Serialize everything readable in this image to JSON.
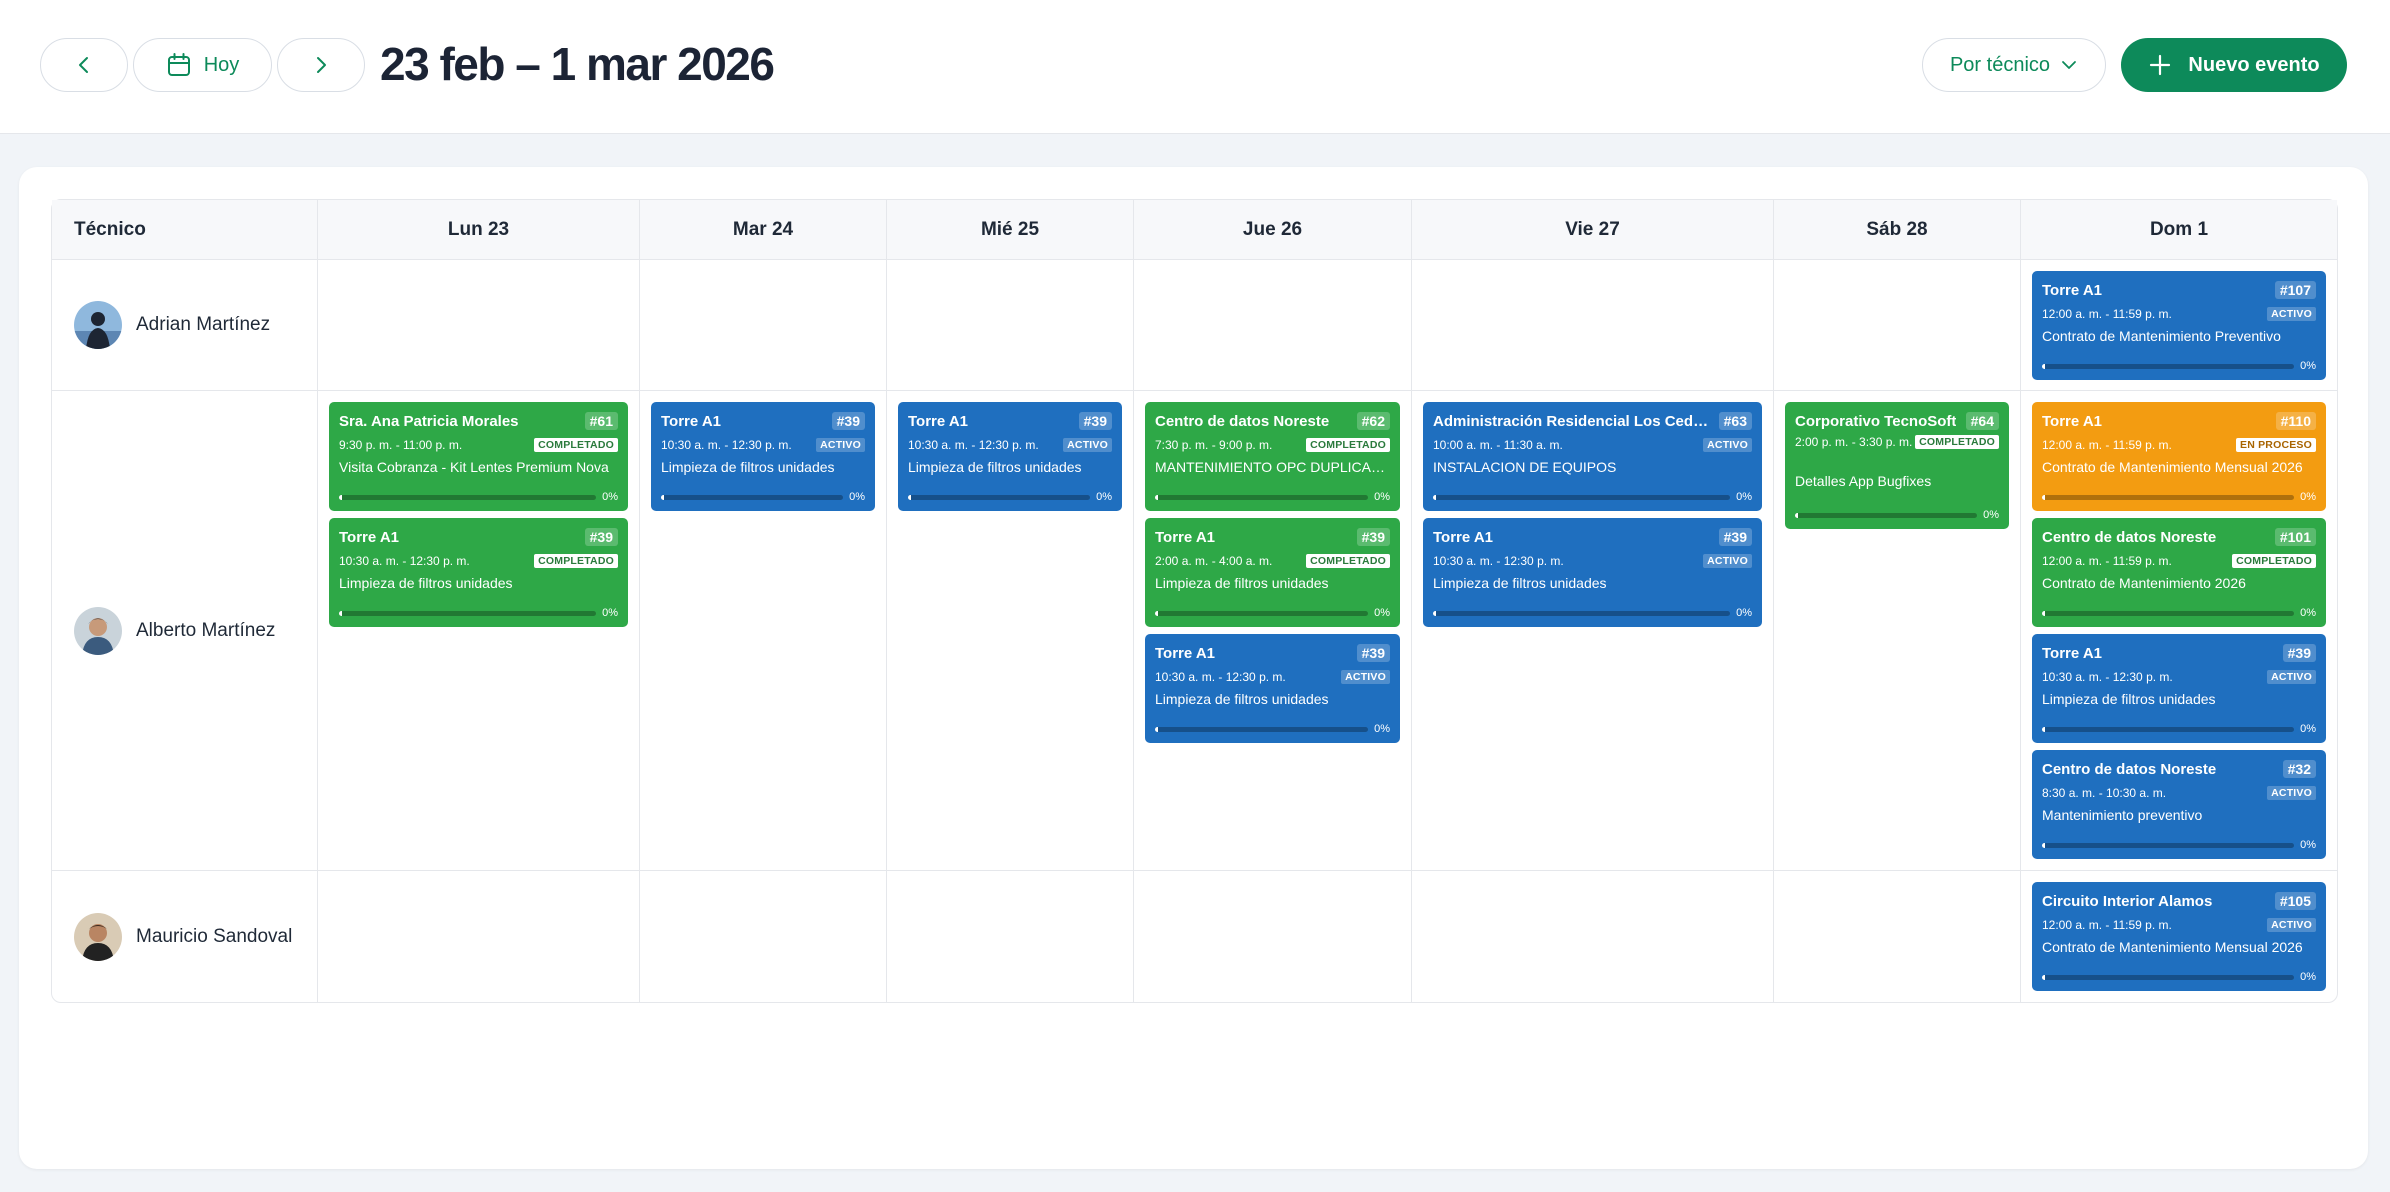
{
  "header": {
    "today_label": "Hoy",
    "range_title": "23 feb – 1 mar 2026",
    "group_by_label": "Por técnico",
    "new_event_label": "Nuevo evento"
  },
  "columns": {
    "tech": "Técnico",
    "days": [
      "Lun 23",
      "Mar 24",
      "Mié 25",
      "Jue 26",
      "Vie 27",
      "Sáb 28",
      "Dom 1"
    ]
  },
  "colors": {
    "accent": "#0d8a5a",
    "completed": "#2ea847",
    "active": "#1f6fbf",
    "in_progress": "#f39c11"
  },
  "technicians": [
    {
      "name": "Adrian Martínez"
    },
    {
      "name": "Alberto Martínez"
    },
    {
      "name": "Mauricio Sandoval"
    }
  ],
  "events": {
    "e107": {
      "title": "Torre A1",
      "num": "#107",
      "time": "12:00 a. m. - 11:59 p. m.",
      "status": "ACTIVO",
      "desc": "Contrato de Mantenimiento Preventivo",
      "progress": "0%"
    },
    "e61": {
      "title": "Sra. Ana Patricia Morales",
      "num": "#61",
      "time": "9:30 p. m. - 11:00 p. m.",
      "status": "COMPLETADO",
      "desc": "Visita Cobranza - Kit Lentes Premium Nova",
      "progress": "0%"
    },
    "e39a": {
      "title": "Torre A1",
      "num": "#39",
      "time": "10:30 a. m. - 12:30 p. m.",
      "status": "COMPLETADO",
      "desc": "Limpieza de filtros unidades",
      "progress": "0%"
    },
    "e39b": {
      "title": "Torre A1",
      "num": "#39",
      "time": "10:30 a. m. - 12:30 p. m.",
      "status": "ACTIVO",
      "desc": "Limpieza de filtros unidades",
      "progress": "0%"
    },
    "e39c": {
      "title": "Torre A1",
      "num": "#39",
      "time": "10:30 a. m. - 12:30 p. m.",
      "status": "ACTIVO",
      "desc": "Limpieza de filtros unidades",
      "progress": "0%"
    },
    "e62": {
      "title": "Centro de datos Noreste",
      "num": "#62",
      "time": "7:30 p. m. - 9:00 p. m.",
      "status": "COMPLETADO",
      "desc": "MANTENIMIENTO OPC DUPLICADAS",
      "progress": "0%"
    },
    "e39d": {
      "title": "Torre A1",
      "num": "#39",
      "time": "2:00 a. m. - 4:00 a. m.",
      "status": "COMPLETADO",
      "desc": "Limpieza de filtros unidades",
      "progress": "0%"
    },
    "e39e": {
      "title": "Torre A1",
      "num": "#39",
      "time": "10:30 a. m. - 12:30 p. m.",
      "status": "ACTIVO",
      "desc": "Limpieza de filtros unidades",
      "progress": "0%"
    },
    "e63": {
      "title": "Administración Residencial Los Cedros",
      "num": "#63",
      "time": "10:00 a. m. - 11:30 a. m.",
      "status": "ACTIVO",
      "desc": "INSTALACION DE EQUIPOS",
      "progress": "0%"
    },
    "e39f": {
      "title": "Torre A1",
      "num": "#39",
      "time": "10:30 a. m. - 12:30 p. m.",
      "status": "ACTIVO",
      "desc": "Limpieza de filtros unidades",
      "progress": "0%"
    },
    "e64": {
      "title": "Corporativo TecnoSoft",
      "num": "#64",
      "time": "2:00 p. m. - 3:30 p. m.",
      "status": "COMPLETADO",
      "desc": "Detalles App Bugfixes",
      "progress": "0%"
    },
    "e110": {
      "title": "Torre A1",
      "num": "#110",
      "time": "12:00 a. m. - 11:59 p. m.",
      "status": "EN PROCESO",
      "desc": "Contrato de Mantenimiento Mensual 2026",
      "progress": "0%"
    },
    "e101": {
      "title": "Centro de datos Noreste",
      "num": "#101",
      "time": "12:00 a. m. - 11:59 p. m.",
      "status": "COMPLETADO",
      "desc": "Contrato de Mantenimiento 2026",
      "progress": "0%"
    },
    "e39g": {
      "title": "Torre A1",
      "num": "#39",
      "time": "10:30 a. m. - 12:30 p. m.",
      "status": "ACTIVO",
      "desc": "Limpieza de filtros unidades",
      "progress": "0%"
    },
    "e32": {
      "title": "Centro de datos Noreste",
      "num": "#32",
      "time": "8:30 a. m. - 10:30 a. m.",
      "status": "ACTIVO",
      "desc": "Mantenimiento preventivo",
      "progress": "0%"
    },
    "e105": {
      "title": "Circuito Interior Alamos",
      "num": "#105",
      "time": "12:00 a. m. - 11:59 p. m.",
      "status": "ACTIVO",
      "desc": "Contrato de Mantenimiento Mensual 2026",
      "progress": "0%"
    }
  }
}
